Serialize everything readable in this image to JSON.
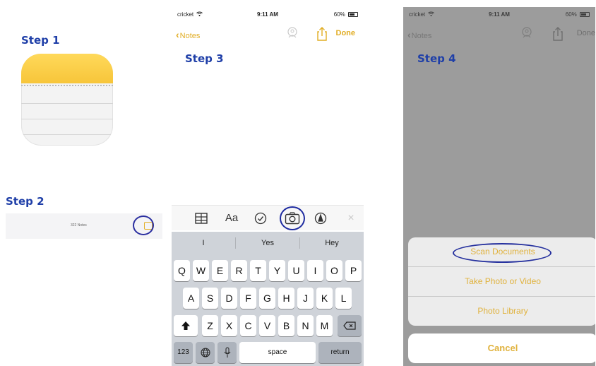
{
  "steps": {
    "step1": "Step 1",
    "step2": "Step 2",
    "step3": "Step 3",
    "step4": "Step 4"
  },
  "step2": {
    "notes_count": "322 Notes",
    "compose_icon": "compose-icon"
  },
  "status_bar": {
    "carrier": "cricket",
    "time": "9:11 AM",
    "battery": "60%"
  },
  "nav": {
    "back_label": "Notes",
    "done_label": "Done",
    "add_people_icon": "add-people-icon",
    "share_icon": "share-icon"
  },
  "format_toolbar": {
    "table_icon": "table-icon",
    "text_style_label": "Aa",
    "checklist_icon": "checklist-icon",
    "camera_icon": "camera-icon",
    "markup_icon": "markup-icon",
    "close_icon": "close-icon"
  },
  "predictive": [
    "I",
    "Yes",
    "Hey"
  ],
  "keyboard": {
    "row1": [
      "Q",
      "W",
      "E",
      "R",
      "T",
      "Y",
      "U",
      "I",
      "O",
      "P"
    ],
    "row2": [
      "A",
      "S",
      "D",
      "F",
      "G",
      "H",
      "J",
      "K",
      "L"
    ],
    "row3": [
      "Z",
      "X",
      "C",
      "V",
      "B",
      "N",
      "M"
    ],
    "numbers_label": "123",
    "space_label": "space",
    "return_label": "return",
    "shift_icon": "shift-icon",
    "delete_icon": "delete-icon",
    "globe_icon": "globe-icon",
    "mic_icon": "mic-icon"
  },
  "action_sheet": {
    "scan_documents": "Scan Documents",
    "take_photo": "Take Photo or Video",
    "photo_library": "Photo Library",
    "cancel": "Cancel"
  },
  "colors": {
    "step_label": "#1f3fa8",
    "accent_yellow": "#e1ad24",
    "highlight_ring": "#25309e"
  }
}
